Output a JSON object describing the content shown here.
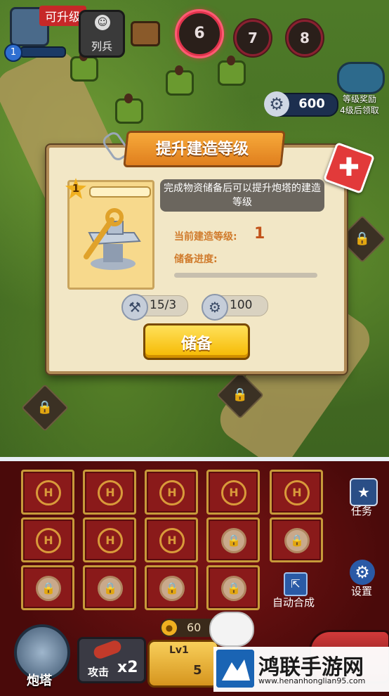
{
  "hud": {
    "upgradable_tag": "可升级",
    "player_level": "1",
    "troops_label": "列兵",
    "stages": [
      "6",
      "7",
      "8"
    ],
    "current_stage": "6",
    "gear_count": "600",
    "level_reward": {
      "title": "等级奖励",
      "subtitle": "4级后领取"
    }
  },
  "dialog": {
    "title": "提升建造等级",
    "item_level": "1",
    "description": "完成物资储备后可以提升炮塔的建造等级",
    "current_level_label": "当前建造等级:",
    "current_level_value": "1",
    "progress_label": "储备进度:",
    "progress": 0,
    "costs": [
      {
        "icon": "parts-icon",
        "value": "15/3"
      },
      {
        "icon": "gear-icon",
        "value": "100"
      }
    ],
    "reserve_button": "储备"
  },
  "board": {
    "side": {
      "task_label": "任务",
      "settings_label": "设置",
      "auto_merge_label": "自动合成"
    },
    "slot_symbol": "H",
    "slots": [
      "empty",
      "empty",
      "empty",
      "empty",
      "empty",
      "empty",
      "empty",
      "empty",
      "locked",
      "locked",
      "locked",
      "locked",
      "locked",
      "locked"
    ]
  },
  "bottom": {
    "tower_label": "炮塔",
    "attack_label": "攻击",
    "attack_multiplier": "x2",
    "coin_value": "60",
    "build_level": "Lv1",
    "build_cost": "5"
  },
  "watermark": {
    "title": "鸿联手游网",
    "url": "www.henanhonglian95.com"
  },
  "colors": {
    "accent_orange": "#e58a22",
    "close_red": "#e23a3a",
    "button_yellow": "#f5b800",
    "board_red": "#7a1414"
  }
}
